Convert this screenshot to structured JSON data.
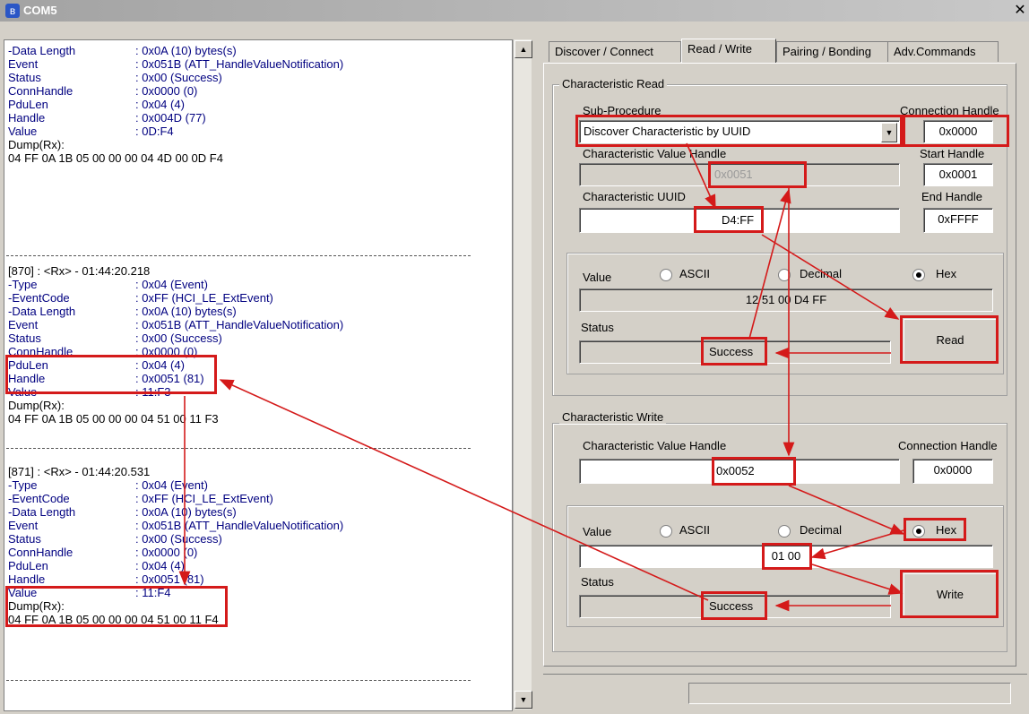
{
  "window": {
    "title": "COM5"
  },
  "log": {
    "block0": [
      [
        "-Data Length",
        ": 0x0A (10) bytes(s)"
      ],
      [
        "Event",
        ": 0x051B (ATT_HandleValueNotification)"
      ],
      [
        "Status",
        ": 0x00 (Success)"
      ],
      [
        "ConnHandle",
        ": 0x0000 (0)"
      ],
      [
        "PduLen",
        ": 0x04 (4)"
      ],
      [
        "Handle",
        ": 0x004D (77)"
      ],
      [
        "Value",
        ": 0D:F4"
      ]
    ],
    "block0_dump_label": "Dump(Rx):",
    "block0_dump": "04 FF 0A 1B 05 00 00 00 04 4D 00 0D F4",
    "block1_header": "[870] : <Rx> - 01:44:20.218",
    "block1": [
      [
        "-Type",
        ": 0x04 (Event)"
      ],
      [
        "-EventCode",
        ": 0xFF (HCI_LE_ExtEvent)"
      ],
      [
        "-Data Length",
        ": 0x0A (10) bytes(s)"
      ],
      [
        "Event",
        ": 0x051B (ATT_HandleValueNotification)"
      ],
      [
        "Status",
        ": 0x00 (Success)"
      ],
      [
        "ConnHandle",
        ": 0x0000 (0)"
      ],
      [
        "PduLen",
        ": 0x04 (4)"
      ],
      [
        "Handle",
        ": 0x0051 (81)"
      ],
      [
        "Value",
        ": 11:F3"
      ]
    ],
    "block1_dump_label": "Dump(Rx):",
    "block1_dump": "04 FF 0A 1B 05 00 00 00 04 51 00 11 F3",
    "block2_header": "[871] : <Rx> - 01:44:20.531",
    "block2": [
      [
        "-Type",
        ": 0x04 (Event)"
      ],
      [
        "-EventCode",
        ": 0xFF (HCI_LE_ExtEvent)"
      ],
      [
        "-Data Length",
        ": 0x0A (10) bytes(s)"
      ],
      [
        "Event",
        ": 0x051B (ATT_HandleValueNotification)"
      ],
      [
        "Status",
        ": 0x00 (Success)"
      ],
      [
        "ConnHandle",
        ": 0x0000 (0)"
      ],
      [
        "PduLen",
        ": 0x04 (4)"
      ],
      [
        "Handle",
        ": 0x0051 (81)"
      ],
      [
        "Value",
        ": 11:F4"
      ]
    ],
    "block2_dump_label": "Dump(Rx):",
    "block2_dump": "04 FF 0A 1B 05 00 00 00 04 51 00 11 F4"
  },
  "tabs": [
    "Discover / Connect",
    "Read / Write",
    "Pairing / Bonding",
    "Adv.Commands"
  ],
  "char_read": {
    "group_label": "Characteristic Read",
    "sub_procedure_label": "Sub-Procedure",
    "sub_procedure_value": "Discover Characteristic by UUID",
    "value_handle_label": "Characteristic Value Handle",
    "value_handle": "0x0051",
    "uuid_label": "Characteristic UUID",
    "uuid": "D4:FF",
    "conn_handle_label": "Connection Handle",
    "conn_handle": "0x0000",
    "start_handle_label": "Start Handle",
    "start_handle": "0x0001",
    "end_handle_label": "End Handle",
    "end_handle": "0xFFFF",
    "value_label": "Value",
    "radio_ascii": "ASCII",
    "radio_decimal": "Decimal",
    "radio_hex": "Hex",
    "selected_format": "Hex",
    "value": "12 51 00 D4 FF",
    "status_label": "Status",
    "status": "Success",
    "read_button": "Read"
  },
  "char_write": {
    "group_label": "Characteristic Write",
    "value_handle_label": "Characteristic Value Handle",
    "value_handle": "0x0052",
    "conn_handle_label": "Connection Handle",
    "conn_handle": "0x0000",
    "value_label": "Value",
    "radio_ascii": "ASCII",
    "radio_decimal": "Decimal",
    "radio_hex": "Hex",
    "selected_format": "Hex",
    "value": "01 00",
    "status_label": "Status",
    "status": "Success",
    "write_button": "Write"
  },
  "colors": {
    "highlight": "#d41a1a",
    "log_text": "#000080",
    "window_bg": "#d4d0c8"
  }
}
